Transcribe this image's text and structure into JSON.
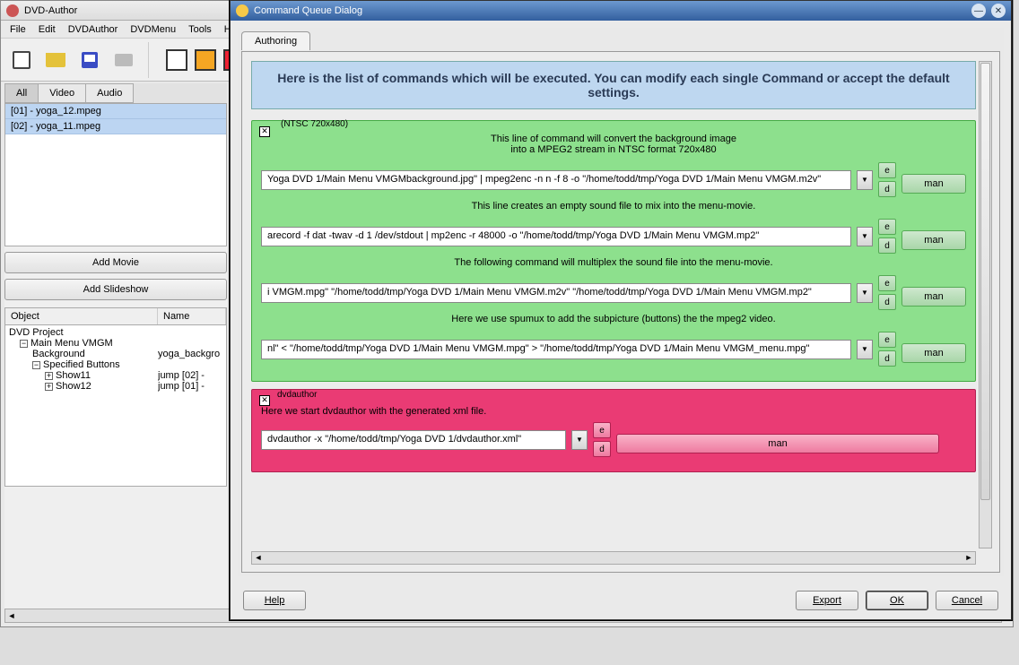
{
  "main": {
    "title": "DVD-Author",
    "menu": [
      "File",
      "Edit",
      "DVDAuthor",
      "DVDMenu",
      "Tools",
      "Help"
    ],
    "tabs": {
      "all": "All",
      "video": "Video",
      "audio": "Audio"
    },
    "files": [
      "[01] - yoga_12.mpeg",
      "[02] - yoga_11.mpeg"
    ],
    "add_movie": "Add Movie",
    "add_slideshow": "Add Slideshow",
    "tree_hdr": {
      "c1": "Object",
      "c2": "Name"
    },
    "tree": [
      {
        "c1": "DVD Project",
        "c2": "",
        "ind": 0,
        "t": ""
      },
      {
        "c1": "Main Menu VMGM",
        "c2": "",
        "ind": 1,
        "t": "−"
      },
      {
        "c1": "Background",
        "c2": "yoga_backgro",
        "ind": 2,
        "t": ""
      },
      {
        "c1": "Specified Buttons",
        "c2": "",
        "ind": 2,
        "t": "−"
      },
      {
        "c1": "Show11",
        "c2": "jump [02] - ",
        "ind": 3,
        "t": "+"
      },
      {
        "c1": "Show12",
        "c2": "jump [01] - ",
        "ind": 3,
        "t": "+"
      }
    ]
  },
  "dialog": {
    "title": "Command Queue Dialog",
    "tab": "Authoring",
    "banner": "Here is the list of commands which will be executed. You can modify each single Command or accept the default settings.",
    "green": {
      "title": "(NTSC 720x480)",
      "items": [
        {
          "desc": "This line of command will convert the background image\ninto a MPEG2 stream in NTSC format 720x480",
          "cmd": "Yoga DVD 1/Main Menu VMGMbackground.jpg\" | mpeg2enc -n n -f 8 -o \"/home/todd/tmp/Yoga DVD 1/Main Menu VMGM.m2v\""
        },
        {
          "desc": "This line creates an empty sound file to mix into the menu-movie.",
          "cmd": "arecord -f dat -twav -d 1 /dev/stdout | mp2enc -r 48000 -o \"/home/todd/tmp/Yoga DVD 1/Main Menu VMGM.mp2\""
        },
        {
          "desc": "The following command will multiplex the sound file into the menu-movie.",
          "cmd": "i VMGM.mpg\" \"/home/todd/tmp/Yoga DVD 1/Main Menu VMGM.m2v\" \"/home/todd/tmp/Yoga DVD 1/Main Menu VMGM.mp2\""
        },
        {
          "desc": "Here we use spumux to add the subpicture (buttons) the the mpeg2 video.",
          "cmd": "nl\" < \"/home/todd/tmp/Yoga DVD 1/Main Menu VMGM.mpg\" > \"/home/todd/tmp/Yoga DVD 1/Main Menu VMGM_menu.mpg\""
        }
      ]
    },
    "red": {
      "title": "dvdauthor",
      "desc": "Here we start dvdauthor with the generated xml file.",
      "cmd": "dvdauthor -x \"/home/todd/tmp/Yoga DVD 1/dvdauthor.xml\""
    },
    "labels": {
      "e": "e",
      "d": "d",
      "man": "man"
    },
    "buttons": {
      "help": "Help",
      "export": "Export",
      "ok": "OK",
      "cancel": "Cancel"
    }
  }
}
